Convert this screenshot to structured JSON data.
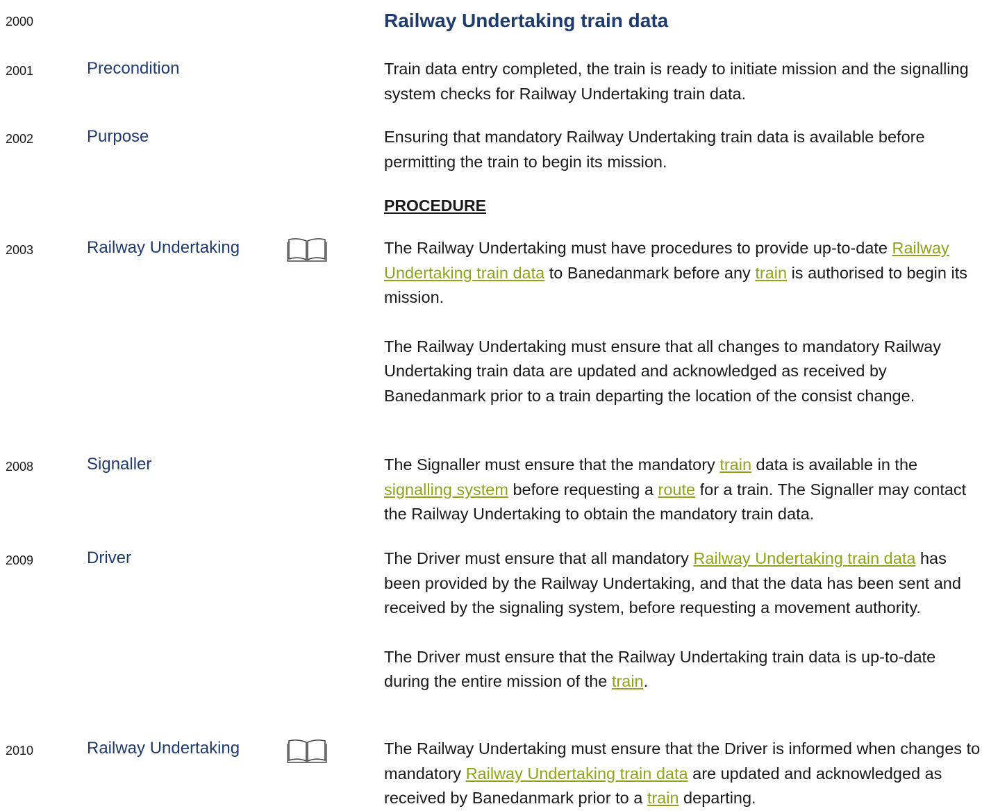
{
  "title": "Railway Undertaking train data",
  "procedure_heading": "PROCEDURE",
  "rows": {
    "r2000": {
      "num": "2000"
    },
    "r2001": {
      "num": "2001",
      "role": "Precondition",
      "text": "Train data entry completed, the train is ready to initiate mission and the signalling system checks for Railway Undertaking train data."
    },
    "r2002": {
      "num": "2002",
      "role": "Purpose",
      "text": "Ensuring that mandatory Railway Undertaking train data is available before permitting the train to begin its mission."
    },
    "r2003": {
      "num": "2003",
      "role": "Railway Undertaking",
      "p1": {
        "a": "The Railway Undertaking must have procedures to provide up-to-date ",
        "link1": "Railway Undertaking train data",
        "b": " to Banedanmark before any ",
        "link2": "train",
        "c": " is authorised to begin its mission."
      },
      "p2": "The Railway Undertaking must ensure that all changes to mandatory Railway Undertaking train data are updated and acknowledged as received by Banedanmark prior to a train departing the location of the consist change."
    },
    "r2008": {
      "num": "2008",
      "role": "Signaller",
      "a": "The Signaller must ensure that the mandatory ",
      "link1": "train",
      "b": " data is available in the ",
      "link2": "signalling system",
      "c": " before requesting a ",
      "link3": "route",
      "d": " for a train. The Signaller may contact the Railway Undertaking to obtain the mandatory train data."
    },
    "r2009": {
      "num": "2009",
      "role": "Driver",
      "p1": {
        "a": "The Driver must ensure that all mandatory ",
        "link1": "Railway Undertaking train data",
        "b": " has been provided by the Railway Undertaking, and that the data has been sent and received by the signaling system, before requesting a movement authority."
      },
      "p2": {
        "a": "The Driver must ensure that the Railway Undertaking train data is up-to-date during the entire mission of the ",
        "link1": "train",
        "b": "."
      }
    },
    "r2010": {
      "num": "2010",
      "role": "Railway Undertaking",
      "a": "The Railway Undertaking must ensure that the Driver is informed when changes to mandatory ",
      "link1": "Railway Undertaking train data",
      "b": " are updated and acknowledged as received by Banedanmark prior to a ",
      "link2": "train",
      "c": " departing."
    }
  }
}
